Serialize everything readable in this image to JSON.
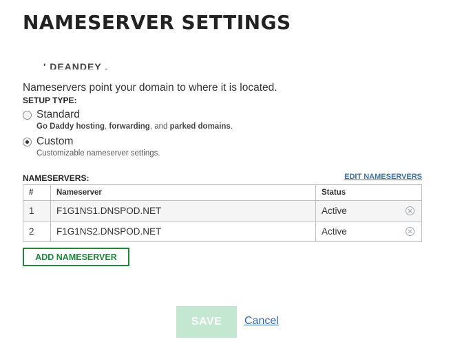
{
  "page": {
    "title": "NAMESERVER SETTINGS",
    "clipped_text": "' DEANDEY       ,"
  },
  "setup": {
    "description": "Nameservers point your domain to where it is located.",
    "label": "SETUP TYPE:",
    "options": [
      {
        "label": "Standard",
        "checked": false,
        "help_parts": [
          "Go Daddy hosting",
          ", ",
          "forwarding",
          ", and ",
          "parked domains",
          "."
        ]
      },
      {
        "label": "Custom",
        "checked": true,
        "help": "Customizable nameserver settings."
      }
    ]
  },
  "nameservers": {
    "label": "NAMESERVERS:",
    "edit_link": "EDIT NAMESERVERS",
    "columns": [
      "#",
      "Nameserver",
      "Status"
    ],
    "rows": [
      {
        "num": "1",
        "name": "F1G1NS1.DNSPOD.NET",
        "status": "Active",
        "remove_icon": "remove-circle-icon"
      },
      {
        "num": "2",
        "name": "F1G1NS2.DNSPOD.NET",
        "status": "Active",
        "remove_icon": "remove-circle-icon"
      }
    ],
    "add_button": "ADD NAMESERVER"
  },
  "footer": {
    "save": "SAVE",
    "cancel": "Cancel"
  },
  "colors": {
    "accent_green": "#1b8a3a",
    "save_disabled": "#c3e7d0",
    "link_blue": "#2f67b1"
  }
}
